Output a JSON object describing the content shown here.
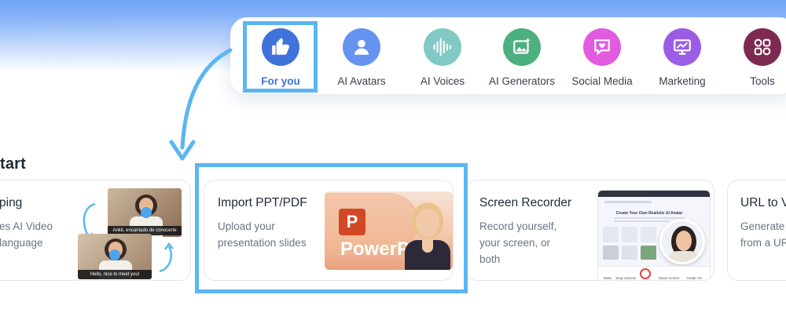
{
  "categories": [
    {
      "label": "For you",
      "icon": "thumbs-up-icon",
      "color": "#3f73d9",
      "active": true
    },
    {
      "label": "AI Avatars",
      "icon": "user-avatar-icon",
      "color": "#6593f0"
    },
    {
      "label": "AI Voices",
      "icon": "voice-waveform-icon",
      "color": "#82c9c5"
    },
    {
      "label": "AI Generators",
      "icon": "image-sparkle-icon",
      "color": "#4caf7e"
    },
    {
      "label": "Social Media",
      "icon": "heart-message-icon",
      "color": "#e25ce0"
    },
    {
      "label": "Marketing",
      "icon": "presentation-chart-icon",
      "color": "#9b5de5"
    },
    {
      "label": "Tools",
      "icon": "tools-grid-icon",
      "color": "#7d2a52"
    }
  ],
  "section": {
    "title": "tart"
  },
  "cards": [
    {
      "title": "ping",
      "description": [
        "es AI Video",
        "language"
      ],
      "thumbnail": {
        "caption_top": "Ankit, encantado de conocerte",
        "caption_bottom": "Hello, nice to meet you!"
      }
    },
    {
      "title": "Import PPT/PDF",
      "description": [
        "Upload your",
        "presentation slides"
      ],
      "thumbnail": {
        "app_letter": "P",
        "banner_text": "PowerP"
      }
    },
    {
      "title": "Screen Recorder",
      "description": [
        "Record yourself,",
        "your screen, or",
        "both"
      ],
      "thumbnail": {
        "page_heading": "Create Your Own Realistic AI Avatar",
        "controls": [
          "Mute",
          "Stop camera",
          "Share screen",
          "Avatar On"
        ]
      }
    },
    {
      "title": "URL to V",
      "description": [
        "Generate",
        "from a UR"
      ]
    }
  ],
  "colors": {
    "highlight": "#5bb6f1",
    "arrow": "#5bb6f1",
    "powerpoint": "#d24726"
  }
}
